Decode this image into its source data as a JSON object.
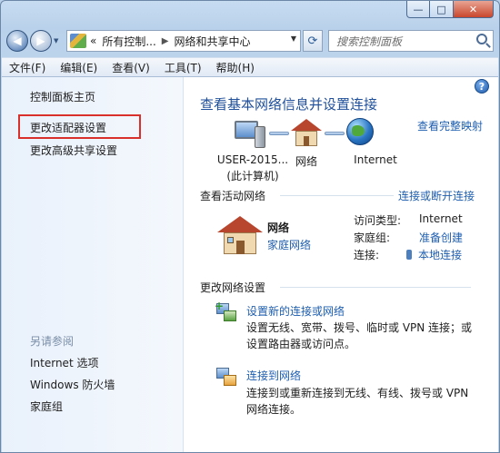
{
  "window": {
    "caption": {
      "minimize": "—",
      "maximize": "□",
      "close": "✕"
    }
  },
  "nav": {
    "back_icon": "back-arrow-icon",
    "address": {
      "root_marker": "«",
      "crumbs": [
        "所有控制...",
        "网络和共享中心"
      ]
    },
    "refresh_icon": "refresh-icon",
    "search_placeholder": "搜索控制面板"
  },
  "menu": [
    "文件(F)",
    "编辑(E)",
    "查看(V)",
    "工具(T)",
    "帮助(H)"
  ],
  "sidebar": {
    "items": [
      {
        "label": "控制面板主页"
      },
      {
        "label": "更改适配器设置"
      },
      {
        "label": "更改高级共享设置"
      }
    ],
    "see_also_title": "另请参阅",
    "see_also": [
      "Internet 选项",
      "Windows 防火墙",
      "家庭组"
    ],
    "highlight_color": "#d9302c"
  },
  "main": {
    "help": "?",
    "title": "查看基本网络信息并设置连接",
    "full_map_link": "查看完整映射",
    "map": {
      "computer_label_line1": "USER-2015...",
      "computer_label_line2": "(此计算机)",
      "network_label": "网络",
      "internet_label": "Internet"
    },
    "active": {
      "heading": "查看活动网络",
      "connect_link": "连接或断开连接",
      "network_name": "网络",
      "network_type": "家庭网络",
      "access_type_label": "访问类型:",
      "access_type_value": "Internet",
      "homegroup_label": "家庭组:",
      "homegroup_value": "准备创建",
      "connection_label": "连接:",
      "connection_value": "本地连接"
    },
    "change": {
      "heading": "更改网络设置",
      "task1_link": "设置新的连接或网络",
      "task1_desc_line1": "设置无线、宽带、拨号、临时或 VPN 连接；或",
      "task1_desc_line2": "设置路由器或访问点。",
      "task2_link": "连接到网络",
      "task2_desc_line1": "连接到或重新连接到无线、有线、拨号或 VPN",
      "task2_desc_line2": "网络连接。"
    }
  },
  "colors": {
    "link": "#1e5eaf",
    "title": "#1f4f9a"
  }
}
